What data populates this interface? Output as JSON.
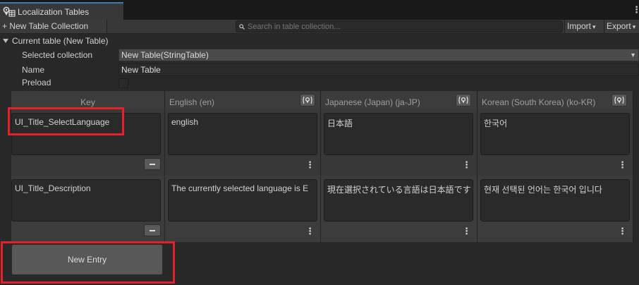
{
  "window": {
    "tab_title": "Localization Tables",
    "menu_glyph": "⋮"
  },
  "toolbar": {
    "new_collection": "+ New Table Collection",
    "search_placeholder": "Search in table collection...",
    "import_label": "Import",
    "export_label": "Export",
    "caret": "▾"
  },
  "current_table": {
    "header": "Current table (New Table)",
    "selected_collection_label": "Selected collection",
    "selected_collection_value": "New Table(StringTable)",
    "name_label": "Name",
    "name_value": "New Table",
    "preload_label": "Preload",
    "preload_checked": false
  },
  "table": {
    "columns": [
      {
        "label": "Key"
      },
      {
        "label": "English (en)"
      },
      {
        "label": "Japanese (Japan) (ja-JP)"
      },
      {
        "label": "Korean (South Korea) (ko-KR)"
      }
    ],
    "rows": [
      {
        "key": "UI_Title_SelectLanguage",
        "en": "english",
        "ja": "日本語",
        "ko": "한국어"
      },
      {
        "key": "UI_Title_Description",
        "en": "The currently selected language is E",
        "ja": "現在選択されている言語は日本語です",
        "ko": "현재 선택된 언어는 한국어 입니다"
      }
    ],
    "kebab_glyph": "⋮"
  },
  "new_entry_label": "New Entry",
  "colors": {
    "highlight": "#e3212a",
    "tab_accent": "#3a79bb"
  }
}
